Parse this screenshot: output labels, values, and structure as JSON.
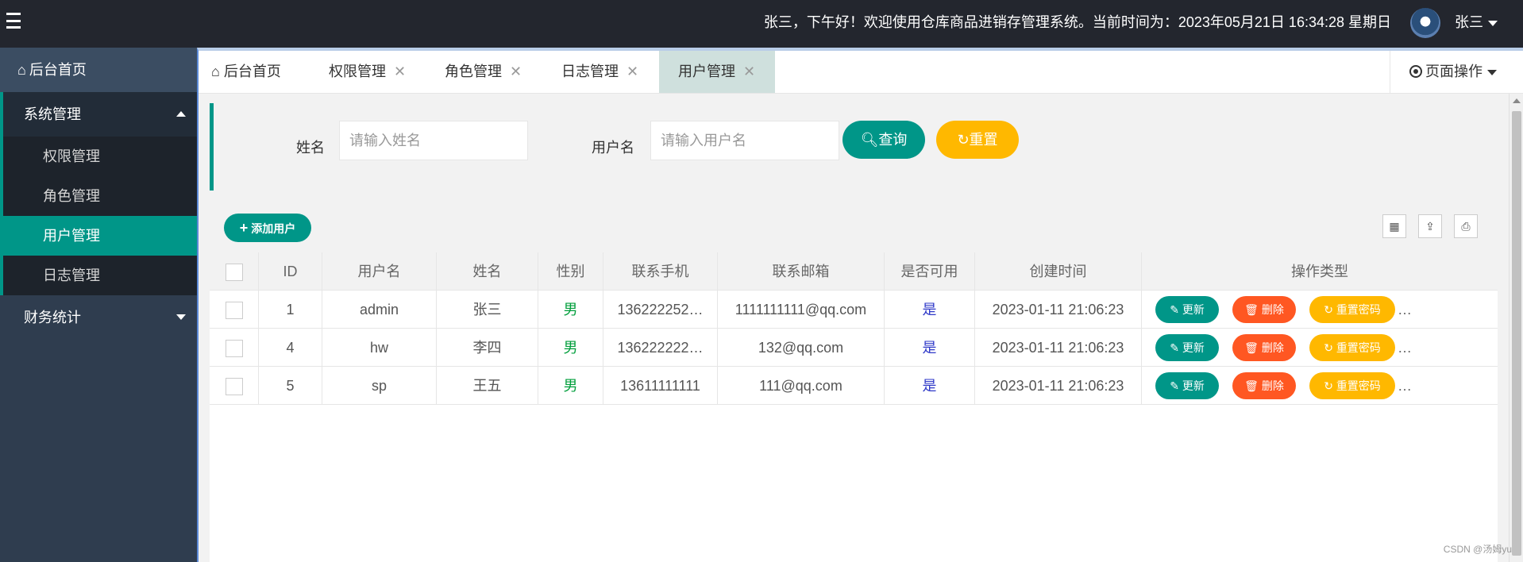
{
  "header": {
    "greeting": "张三，下午好！欢迎使用仓库商品进销存管理系统。当前时间为：2023年05月21日 16:34:28 星期日",
    "user_name": "张三"
  },
  "sidebar": {
    "home": "后台首页",
    "groups": [
      {
        "label": "系统管理",
        "items": [
          "权限管理",
          "角色管理",
          "用户管理",
          "日志管理"
        ]
      },
      {
        "label": "财务统计"
      }
    ]
  },
  "tabs": [
    {
      "label": "后台首页"
    },
    {
      "label": "权限管理"
    },
    {
      "label": "角色管理"
    },
    {
      "label": "日志管理"
    },
    {
      "label": "用户管理"
    }
  ],
  "page_ops": "页面操作",
  "search": {
    "name_label": "姓名",
    "name_placeholder": "请输入姓名",
    "username_label": "用户名",
    "username_placeholder": "请输入用户名",
    "query_label": "查询",
    "reset_label": "重置"
  },
  "table": {
    "add_label": "添加用户",
    "columns": [
      "ID",
      "用户名",
      "姓名",
      "性别",
      "联系手机",
      "联系邮箱",
      "是否可用",
      "创建时间",
      "操作类型"
    ],
    "rows": [
      {
        "id": "1",
        "username": "admin",
        "name": "张三",
        "gender": "男",
        "phone": "136222252…",
        "email": "1111111111@qq.com",
        "enabled": "是",
        "created": "2023-01-11 21:06:23"
      },
      {
        "id": "4",
        "username": "hw",
        "name": "李四",
        "gender": "男",
        "phone": "136222222…",
        "email": "132@qq.com",
        "enabled": "是",
        "created": "2023-01-11 21:06:23"
      },
      {
        "id": "5",
        "username": "sp",
        "name": "王五",
        "gender": "男",
        "phone": "13611111111",
        "email": "111@qq.com",
        "enabled": "是",
        "created": "2023-01-11 21:06:23"
      }
    ],
    "actions": {
      "update": "更新",
      "delete": "删除",
      "reset_password": "重置密码",
      "more": "…"
    }
  },
  "watermark": "CSDN @汤姆yu",
  "colors": {
    "primary": "#009688",
    "danger": "#ff5722",
    "warning": "#ffb800",
    "header_bg": "#23262e",
    "sidebar_bg": "#2f3d4f"
  }
}
